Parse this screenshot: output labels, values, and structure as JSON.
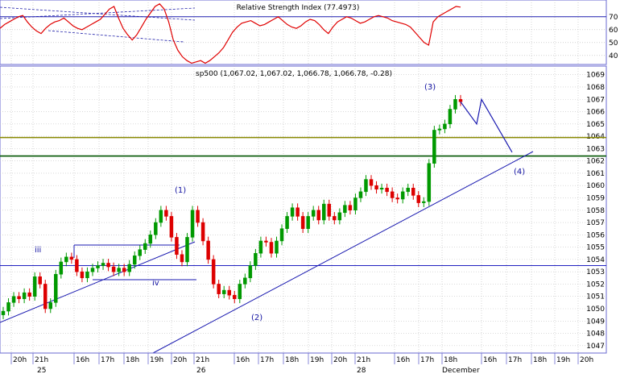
{
  "chart_data": {
    "type": "candlestick",
    "rsi_panel": {
      "title": "Relative Strength Index (77.4973)",
      "y_ticks": [
        40,
        50,
        60,
        70
      ],
      "ylim": [
        33,
        83
      ],
      "overbought_level": 70,
      "line_color": "#e00000",
      "rsi_values": [
        61,
        64,
        66,
        68,
        70,
        71,
        66,
        62,
        59,
        57,
        61,
        64,
        66,
        67,
        69,
        66,
        63,
        61,
        60,
        62,
        64,
        66,
        68,
        72,
        76,
        78,
        69,
        61,
        56,
        52,
        56,
        62,
        68,
        73,
        78,
        80,
        76,
        66,
        52,
        44,
        39,
        36,
        34,
        35,
        36,
        34,
        36,
        39,
        42,
        46,
        52,
        58,
        62,
        65,
        66,
        67,
        65,
        63,
        64,
        66,
        68,
        70,
        67,
        64,
        62,
        61,
        63,
        66,
        68,
        67,
        64,
        60,
        57,
        62,
        66,
        68,
        70,
        69,
        67,
        65,
        66,
        68,
        70,
        71,
        70,
        69,
        67,
        66,
        65,
        64,
        62,
        58,
        54,
        50,
        48,
        66,
        70,
        72,
        74,
        76,
        78,
        77.5
      ]
    },
    "price_panel": {
      "title": "sp500 (1,067.02, 1,067.02, 1,066.78, 1,066.78, -0.28)",
      "y_ticks": [
        1047,
        1048,
        1049,
        1050,
        1051,
        1052,
        1053,
        1054,
        1055,
        1056,
        1057,
        1058,
        1059,
        1060,
        1061,
        1062,
        1063,
        1064,
        1065,
        1066,
        1067,
        1068,
        1069
      ],
      "ylim": [
        1046.4,
        1069.7
      ],
      "up_color": "#009900",
      "down_color": "#dd0000",
      "close_values": [
        1049.8,
        1050.5,
        1051.0,
        1050.8,
        1051.3,
        1051.0,
        1052.6,
        1052.0,
        1050.0,
        1050.5,
        1052.8,
        1053.8,
        1054.2,
        1054.0,
        1053.0,
        1052.5,
        1053.0,
        1053.3,
        1053.5,
        1053.7,
        1053.4,
        1053.0,
        1053.3,
        1053.0,
        1053.6,
        1054.3,
        1054.8,
        1055.3,
        1056.0,
        1057.0,
        1058.0,
        1057.5,
        1055.8,
        1054.4,
        1053.8,
        1055.8,
        1058.0,
        1057.0,
        1055.5,
        1054.0,
        1052.0,
        1051.2,
        1051.5,
        1051.1,
        1050.8,
        1052.0,
        1052.5,
        1053.5,
        1054.5,
        1055.5,
        1055.4,
        1054.5,
        1055.5,
        1056.5,
        1057.5,
        1058.2,
        1057.5,
        1056.5,
        1057.5,
        1058.0,
        1057.2,
        1058.5,
        1057.5,
        1057.2,
        1057.8,
        1058.4,
        1058.0,
        1059.0,
        1059.5,
        1060.5,
        1060.0,
        1059.7,
        1059.8,
        1059.5,
        1059.0,
        1058.9,
        1059.5,
        1059.8,
        1059.2,
        1058.6,
        1058.7,
        1061.8,
        1064.5,
        1064.6,
        1065.0,
        1066.2,
        1067.0,
        1066.8
      ],
      "support_levels": [
        1063.9,
        1062.4,
        1053.5
      ],
      "support_colors": [
        "#888800",
        "#005500",
        "#2020c0"
      ],
      "wave_labels": [
        "iii",
        "iv",
        "(1)",
        "(2)",
        "(3)",
        "(4)"
      ],
      "projection_values": [
        1066.8,
        1065.0,
        1067.0,
        1062.7
      ]
    },
    "x_tick_labels": [
      "20h",
      "21h",
      "16h",
      "17h",
      "18h",
      "19h",
      "20h",
      "21h",
      "16h",
      "17h",
      "18h",
      "19h",
      "20h",
      "21h",
      "16h",
      "17h",
      "18h",
      "16h",
      "17h",
      "18h",
      "19h",
      "20h"
    ],
    "date_labels": [
      "25",
      "26",
      "28",
      "December"
    ],
    "grid": true,
    "y_axis_side": "right"
  }
}
